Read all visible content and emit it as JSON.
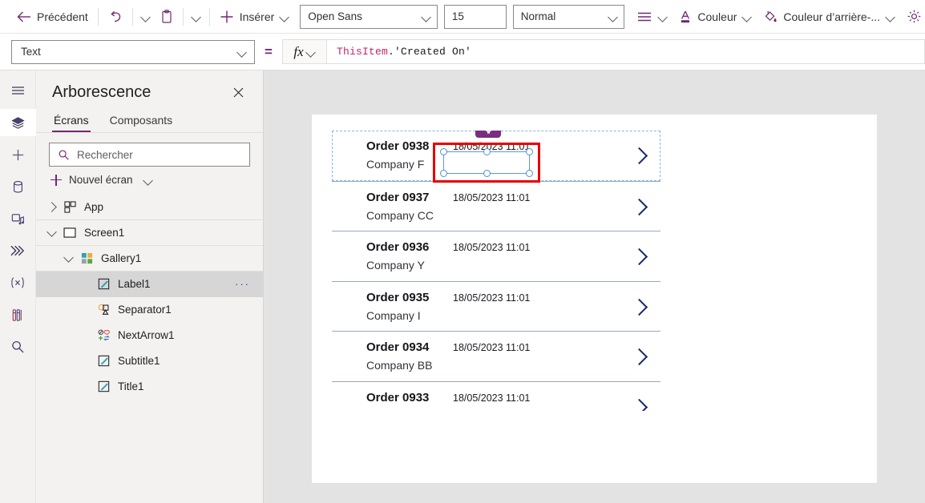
{
  "toolbar": {
    "back_label": "Précédent",
    "undo_icon": "undo-icon",
    "paste_icon": "clipboard-icon",
    "insert_label": "Insérer",
    "font_family_value": "Open Sans",
    "font_size_value": "15",
    "font_weight_value": "Normal",
    "align_icon": "align-lines-icon",
    "color_label": "Couleur",
    "fill_label": "Couleur d’arrière-...",
    "settings_icon": "gear-icon"
  },
  "formula": {
    "property_value": "Text",
    "equals": "=",
    "fx_label": "fx",
    "expression_prefix": "ThisItem",
    "expression_dot": ".",
    "expression_field": "'Created On'"
  },
  "rail": {
    "items": [
      {
        "icon": "hamburger-menu-icon",
        "name": "menu"
      },
      {
        "icon": "layers-tree-icon",
        "name": "tree-view"
      },
      {
        "icon": "plus-insert-icon",
        "name": "insert"
      },
      {
        "icon": "database-cylinder-icon",
        "name": "data"
      },
      {
        "icon": "media-image-note-icon",
        "name": "media"
      },
      {
        "icon": "power-automate-arrows-icon",
        "name": "power-automate"
      },
      {
        "icon": "variables-x-icon",
        "name": "variables"
      },
      {
        "icon": "tools-flask-icon",
        "name": "advanced-tools"
      },
      {
        "icon": "search-magnifier-icon",
        "name": "search"
      }
    ]
  },
  "tree": {
    "title": "Arborescence",
    "close_icon": "close-icon",
    "tabs": [
      {
        "label": "Écrans",
        "selected": true
      },
      {
        "label": "Composants",
        "selected": false
      }
    ],
    "search_placeholder": "Rechercher",
    "search_value": "",
    "search_icon": "search-magnifier-icon",
    "new_screen_label": "Nouvel écran",
    "items": [
      {
        "label": "App",
        "icon": "app-grid-icon",
        "indent": 0,
        "twisty": "collapsed",
        "selected": false
      },
      {
        "label": "Screen1",
        "icon": "screen-rect-icon",
        "indent": 0,
        "twisty": "expanded",
        "selected": false
      },
      {
        "label": "Gallery1",
        "icon": "gallery-squares-icon",
        "indent": 1,
        "twisty": "expanded",
        "selected": false
      },
      {
        "label": "Label1",
        "icon": "label-pencil-icon",
        "indent": 2,
        "twisty": "none",
        "selected": true,
        "overflow": "···"
      },
      {
        "label": "Separator1",
        "icon": "shapes-icon",
        "indent": 2,
        "twisty": "none",
        "selected": false
      },
      {
        "label": "NextArrow1",
        "icon": "icons-group-icon",
        "indent": 2,
        "twisty": "none",
        "selected": false
      },
      {
        "label": "Subtitle1",
        "icon": "label-pencil-icon",
        "indent": 2,
        "twisty": "none",
        "selected": false
      },
      {
        "label": "Title1",
        "icon": "label-pencil-icon",
        "indent": 2,
        "twisty": "none",
        "selected": false
      }
    ]
  },
  "canvas": {
    "selected_control_badge_icon": "globe-lock-icon",
    "selected_control_name": "Label1",
    "gallery": {
      "rows": [
        {
          "title": "Order 0938",
          "subtitle": "Company F",
          "date": "18/05/2023 11:01",
          "selected": true,
          "clipped": false
        },
        {
          "title": "Order 0937",
          "subtitle": "Company CC",
          "date": "18/05/2023 11:01",
          "selected": false,
          "clipped": false
        },
        {
          "title": "Order 0936",
          "subtitle": "Company Y",
          "date": "18/05/2023 11:01",
          "selected": false,
          "clipped": false
        },
        {
          "title": "Order 0935",
          "subtitle": "Company I",
          "date": "18/05/2023 11:01",
          "selected": false,
          "clipped": false
        },
        {
          "title": "Order 0934",
          "subtitle": "Company BB",
          "date": "18/05/2023 11:01",
          "selected": false,
          "clipped": false
        },
        {
          "title": "Order 0933",
          "subtitle": "",
          "date": "18/05/2023 11:01",
          "selected": false,
          "clipped": true
        }
      ],
      "selected_label_text": "18/05/2023 11:01"
    }
  },
  "colors": {
    "accent_purple": "#742774",
    "selection_blue": "#5b9bd5",
    "annotation_red": "#e60000",
    "badge_purple": "#7a2d80",
    "chevron_navy": "#16276b"
  }
}
